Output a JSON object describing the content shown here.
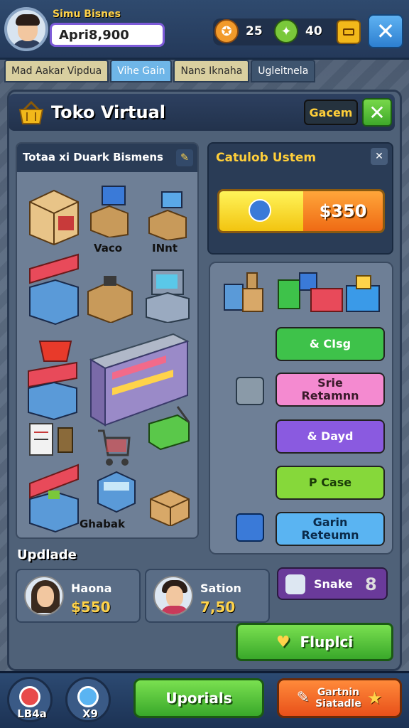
{
  "player": {
    "name": "Simu Bisnes",
    "money": "Apri8,900"
  },
  "resources": [
    {
      "value": "25",
      "icon": "gold-coin-icon"
    },
    {
      "value": "40",
      "icon": "green-gem-icon"
    }
  ],
  "tabs": [
    "Mad Aakar Vipdua",
    "Vihe Gain",
    "Nans Iknaha",
    "Ugleitnela"
  ],
  "header": {
    "title": "Toko Virtual",
    "gbtn": "Gacem"
  },
  "left_card": {
    "title": "Totaa xi Duark Bismens",
    "labels": [
      "Vaco",
      "INnt",
      "Ghabak"
    ]
  },
  "right_card": {
    "title": "Catulob Ustem",
    "price": "$350"
  },
  "actions": [
    {
      "label": "& CIsg",
      "color": "#3ec24a"
    },
    {
      "label": "Srie\nRetamnn",
      "color": "#f48ad0"
    },
    {
      "label": "& Dayd",
      "color": "#8a5ae0"
    },
    {
      "label": "P Case",
      "color": "#86d83a"
    },
    {
      "label": "Garin\nReteumn",
      "color": "#5ab4f2"
    }
  ],
  "update_label": "Updlade",
  "employees": [
    {
      "name": "Haona",
      "salary": "$550"
    },
    {
      "name": "Sation",
      "salary": "7,50"
    }
  ],
  "snake": {
    "name": "Snake",
    "count": "8"
  },
  "plug_btn": "Fluplci",
  "bottom": {
    "left1": "LB4a",
    "left2": "X9",
    "main": "Uporials",
    "right": "Gartnin\nSiatadle"
  }
}
